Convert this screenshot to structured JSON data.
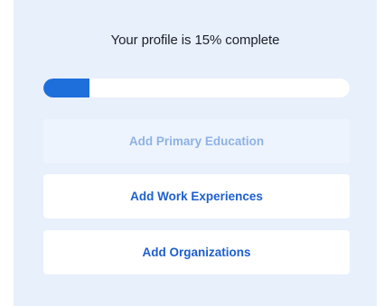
{
  "profile": {
    "title": "Your profile is 15% complete",
    "progress_percent": 15,
    "progress_color": "#1e6fdc"
  },
  "actions": [
    {
      "label": "Add Primary Education",
      "state": "disabled"
    },
    {
      "label": "Add Work Experiences",
      "state": "enabled"
    },
    {
      "label": "Add Organizations",
      "state": "enabled"
    }
  ]
}
